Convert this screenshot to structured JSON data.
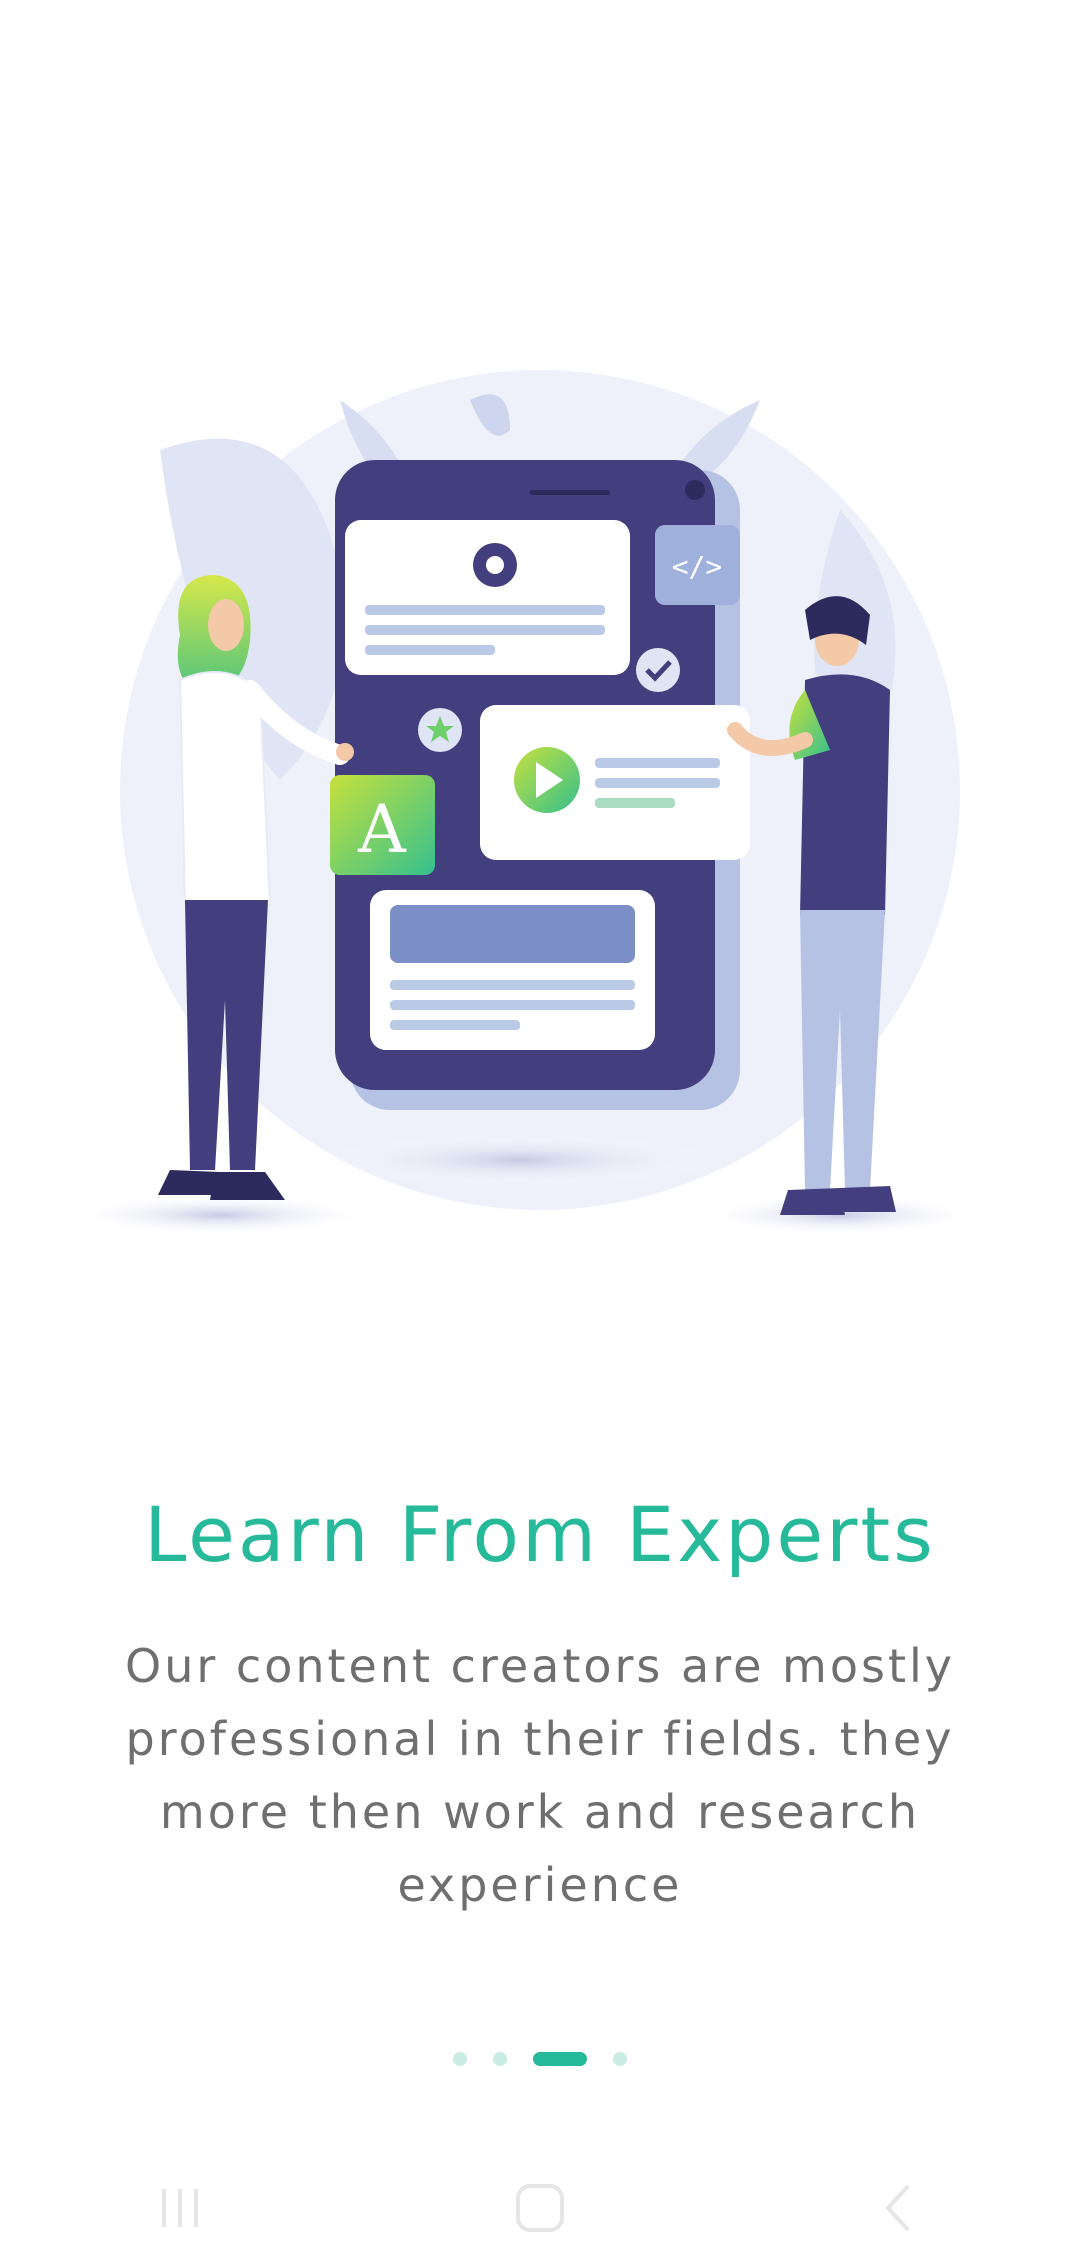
{
  "onboarding": {
    "title": "Learn From Experts",
    "description": "Our content creators are mostly professional in their fields. they more then work and research experience",
    "illustration_icon": "experts-learning-illustration",
    "pager": {
      "count": 4,
      "active_index": 2
    }
  },
  "nav": {
    "recents_icon": "recents-icon",
    "home_icon": "home-icon",
    "back_icon": "back-icon"
  },
  "colors": {
    "accent": "#26b99a",
    "text_secondary": "#6f6f6f",
    "phone": "#433f7e",
    "dot_inactive": "#c8ece3"
  }
}
